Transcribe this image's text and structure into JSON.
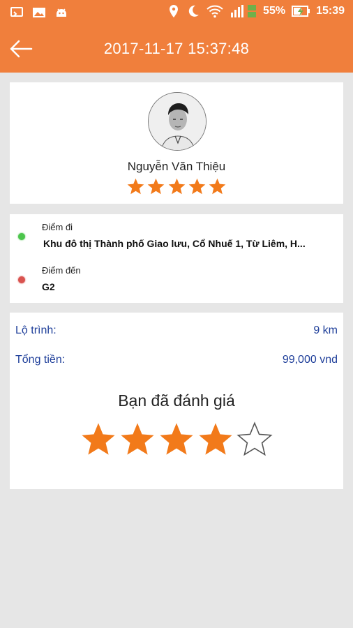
{
  "status_bar": {
    "battery_percent": "55%",
    "time": "15:39",
    "icons": [
      "cast-icon",
      "image-icon",
      "android-icon",
      "location-icon",
      "moon-icon",
      "wifi-icon",
      "signal-icon",
      "battery-charging-icon"
    ]
  },
  "header": {
    "title": "2017-11-17 15:37:48",
    "back_icon": "arrow-left-icon"
  },
  "driver": {
    "name": "Nguyễn Văn Thiệu",
    "rating_stars": 5,
    "max_stars": 5
  },
  "route": {
    "pickup_label": "Điểm đi",
    "pickup_value": "Khu đô thị Thành phố Giao lưu, Cổ Nhuế 1, Từ Liêm, H...",
    "dropoff_label": "Điểm đến",
    "dropoff_value": "G2"
  },
  "summary": {
    "distance_label": "Lộ trình:",
    "distance_value": "9 km",
    "total_label": "Tổng tiền:",
    "total_value": "99,000 vnd"
  },
  "rating": {
    "title": "Bạn đã đánh giá",
    "stars": 4,
    "max_stars": 5
  },
  "colors": {
    "brand": "#f07f3c",
    "star": "#f27a1a",
    "link_text": "#1f3f9a",
    "background": "#e6e6e6"
  }
}
